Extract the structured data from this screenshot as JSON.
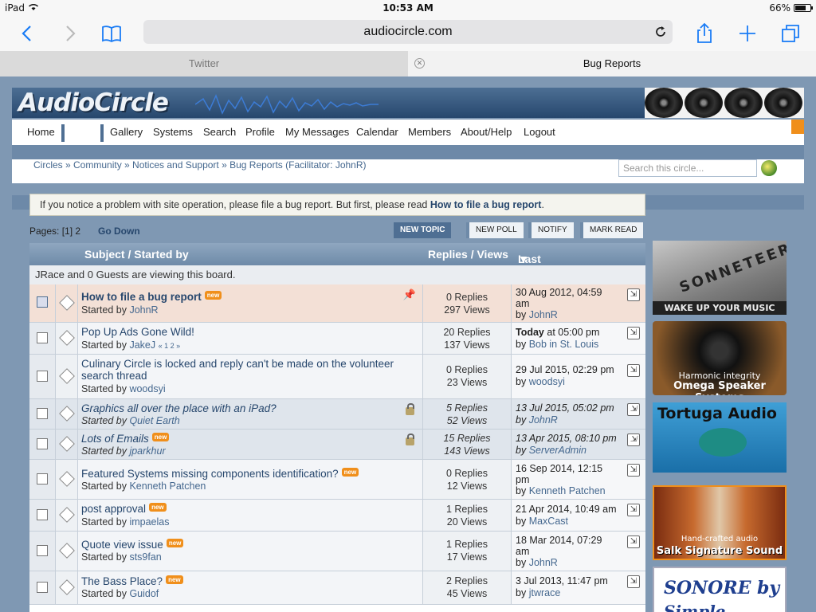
{
  "status": {
    "device": "iPad",
    "time": "10:53 AM",
    "battery": "66%"
  },
  "browser": {
    "url": "audiocircle.com"
  },
  "tabs": [
    {
      "label": "Twitter"
    },
    {
      "label": "Bug Reports"
    }
  ],
  "site": {
    "logo": "AudioCircle"
  },
  "nav": [
    "Home",
    "Gallery",
    "Systems",
    "Search",
    "Profile",
    "My Messages",
    "Calendar",
    "Members",
    "About/Help",
    "Logout"
  ],
  "breadcrumb": "Circles » Community » Notices and Support » Bug Reports (Facilitator: JohnR)",
  "search": {
    "placeholder": "Search this circle..."
  },
  "notice": {
    "text": "If you notice a problem with site operation, please file a bug report. But first, please read ",
    "link": "How to file a bug report",
    "end": "."
  },
  "pagination": {
    "label": "Pages: [1] 2",
    "go_down": "Go Down"
  },
  "buttons": {
    "new_topic": "NEW TOPIC",
    "new_poll": "NEW POLL",
    "notify": "NOTIFY",
    "mark_read": "MARK READ"
  },
  "board": {
    "header": {
      "subject": "Subject / Started by",
      "replies_views": "Replies / Views",
      "last_post": "Last post"
    },
    "viewing": "JRace and 0 Guests are viewing this board.",
    "topics": [
      {
        "subject": "How to file a bug report",
        "new": "new",
        "starter_prefix": "Started by ",
        "starter": "JohnR",
        "replies": "0 Replies",
        "views": "297 Views",
        "last_l1": "30 Aug 2012, 04:59",
        "last_l2": "am",
        "by_prefix": "by ",
        "last_by": "JohnR"
      },
      {
        "subject": "Pop Up Ads Gone Wild!",
        "starter_prefix": "Started by ",
        "starter": "JakeJ",
        "pages": "« 1 2 »",
        "replies": "20 Replies",
        "views": "137 Views",
        "today": "Today",
        "last_l1": " at 05:00 pm",
        "by_prefix": "by ",
        "last_by": "Bob in St. Louis"
      },
      {
        "subject": "Culinary Circle is locked and reply can't be made on the volunteer search thread",
        "starter_prefix": "Started by ",
        "starter": "woodsyi",
        "replies": "0 Replies",
        "views": "23 Views",
        "last_l1": "29 Jul 2015, 02:29 pm",
        "by_prefix": "by ",
        "last_by": "woodsyi"
      },
      {
        "subject": "Graphics all over the place with an iPad?",
        "starter_prefix": "Started by ",
        "starter": "Quiet Earth",
        "replies": "5 Replies",
        "views": "52 Views",
        "last_l1": "13 Jul 2015, 05:02 pm",
        "by_prefix": "by ",
        "last_by": "JohnR"
      },
      {
        "subject": "Lots of Emails",
        "new": "new",
        "starter_prefix": "Started by ",
        "starter": "jparkhur",
        "replies": "15 Replies",
        "views": "143 Views",
        "last_l1": "13 Apr 2015, 08:10 pm",
        "by_prefix": "by ",
        "last_by": "ServerAdmin"
      },
      {
        "subject": "Featured Systems missing components identification?",
        "new": "new",
        "starter_prefix": "Started by ",
        "starter": "Kenneth Patchen",
        "replies": "0 Replies",
        "views": "12 Views",
        "last_l1": "16 Sep 2014, 12:15",
        "last_l2": "pm",
        "by_prefix": "by ",
        "last_by": "Kenneth Patchen"
      },
      {
        "subject": "post approval",
        "new": "new",
        "starter_prefix": "Started by ",
        "starter": "impaelas",
        "replies": "1 Replies",
        "views": "20 Views",
        "last_l1": "21 Apr 2014, 10:49 am",
        "by_prefix": "by ",
        "last_by": "MaxCast"
      },
      {
        "subject": "Quote view issue",
        "new": "new",
        "starter_prefix": "Started by ",
        "starter": "sts9fan",
        "replies": "1 Replies",
        "views": "17 Views",
        "last_l1": "18 Mar 2014, 07:29",
        "last_l2": "am",
        "by_prefix": "by ",
        "last_by": "JohnR"
      },
      {
        "subject": "The Bass Place?",
        "new": "new",
        "starter_prefix": "Started by ",
        "starter": "Guidof",
        "replies": "2 Replies",
        "views": "45 Views",
        "last_l1": "3 Jul 2013, 11:47 pm",
        "by_prefix": "by ",
        "last_by": "jtwrace"
      }
    ]
  },
  "ads": {
    "sonneteer": {
      "brand": "SONNETEER",
      "tagline": "WAKE UP YOUR MUSIC"
    },
    "omega": {
      "line1": "Harmonic integrity",
      "line2": "Omega Speaker Systems"
    },
    "tortuga": {
      "title": "Tortuga Audio"
    },
    "salk": {
      "line1": "Hand-crafted audio",
      "line2": "Salk Signature Sound"
    },
    "sonore": {
      "title": "SONORE by",
      "subtitle": "Simple Design"
    }
  }
}
